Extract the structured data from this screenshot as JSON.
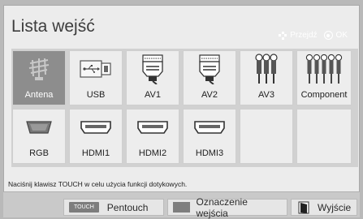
{
  "header": {
    "title": "Lista wejść",
    "nav_label": "Przejdź",
    "ok_label": "OK"
  },
  "inputs": [
    {
      "label": "Antena",
      "icon": "antenna-icon",
      "selected": true
    },
    {
      "label": "USB",
      "icon": "usb-icon",
      "selected": false
    },
    {
      "label": "AV1",
      "icon": "scart-icon",
      "selected": false
    },
    {
      "label": "AV2",
      "icon": "scart-icon",
      "selected": false
    },
    {
      "label": "AV3",
      "icon": "rca-icon",
      "selected": false
    },
    {
      "label": "Component",
      "icon": "component-icon",
      "selected": false
    },
    {
      "label": "RGB",
      "icon": "vga-icon",
      "selected": false
    },
    {
      "label": "HDMI1",
      "icon": "hdmi-icon",
      "selected": false
    },
    {
      "label": "HDMI2",
      "icon": "hdmi-icon",
      "selected": false
    },
    {
      "label": "HDMI3",
      "icon": "hdmi-icon",
      "selected": false
    }
  ],
  "hint_text": "Naciśnij klawisz TOUCH w celu użycia funkcji dotykowych.",
  "bottom": {
    "touch_key": "TOUCH",
    "pentouch_label": "Pentouch",
    "rename_label": "Oznaczenie wejścia",
    "exit_label": "Wyjście"
  },
  "colors": {
    "selected_tile": "#8d8d8d",
    "tile": "#ededed",
    "panel": "#ececec"
  }
}
